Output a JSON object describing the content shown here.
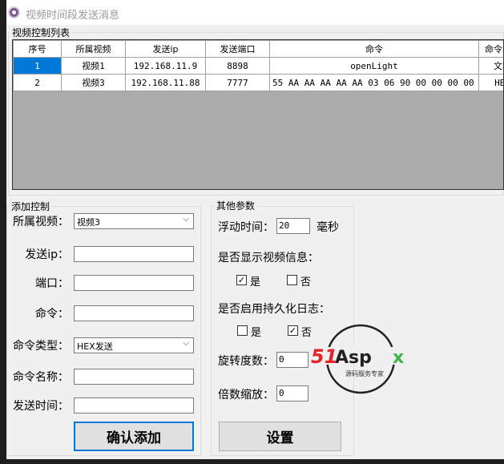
{
  "window": {
    "title": "视频时间段发送消息"
  },
  "list_group": {
    "label": "视频控制列表",
    "columns": [
      "序号",
      "所属视频",
      "发送ip",
      "发送端口",
      "命令",
      "命令类型"
    ],
    "rows": [
      {
        "index": "1",
        "video": "视频1",
        "ip": "192.168.11.9",
        "port": "8898",
        "command": "openLight",
        "type": "文本"
      },
      {
        "index": "2",
        "video": "视频3",
        "ip": "192.168.11.88",
        "port": "7777",
        "command": "55 AA AA AA AA AA 03 06 90 00 00 00 00 ...",
        "type": "HEX"
      }
    ]
  },
  "add_group": {
    "label": "添加控制",
    "video_label": "所属视频：",
    "video_value": "视频3",
    "ip_label": "发送ip：",
    "ip_value": "",
    "port_label": "端口：",
    "port_value": "",
    "command_label": "命令：",
    "command_value": "",
    "type_label": "命令类型：",
    "type_value": "HEX发送",
    "name_label": "命令名称：",
    "name_value": "",
    "time_label": "发送时间：",
    "time_value": "",
    "confirm_label": "确认添加"
  },
  "other_group": {
    "label": "其他参数",
    "float_label": "浮动时间：",
    "float_value": "20",
    "float_unit": "毫秒",
    "show_info_label": "是否显示视频信息：",
    "yes": "是",
    "no": "否",
    "show_info_yes": true,
    "show_info_no": false,
    "persist_label": "是否启用持久化日志：",
    "persist_yes": false,
    "persist_no": true,
    "rotate_label": "旋转度数：",
    "rotate_value": "0",
    "scale_label": "倍数缩放：",
    "scale_value": "0",
    "set_label": "设置"
  },
  "watermark": {
    "brand": "51Aspx",
    "tagline": "源码服务专家"
  },
  "check_mark": "✓"
}
